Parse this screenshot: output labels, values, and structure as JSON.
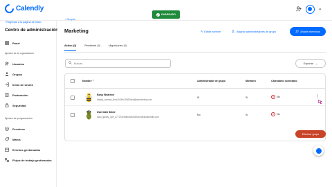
{
  "app": {
    "logo_text": "Calendly",
    "saved_label": "GUARDADO"
  },
  "sidebar": {
    "back_label": "Regresar a la página de inicio",
    "title": "Centro de administración",
    "items_top": [
      {
        "label": "Panel",
        "icon": "grid-icon"
      }
    ],
    "section_org": "Ajustes de la organización",
    "items_org": [
      {
        "label": "Usuarios",
        "icon": "users-icon"
      },
      {
        "label": "Grupos",
        "icon": "groups-icon"
      },
      {
        "label": "Inicio de sesión",
        "icon": "login-icon"
      },
      {
        "label": "Facturación",
        "icon": "billing-icon"
      },
      {
        "label": "Seguridad",
        "icon": "shield-icon"
      }
    ],
    "section_sched": "Ajustes de programación",
    "items_sched": [
      {
        "label": "Permisos",
        "icon": "permissions-icon"
      },
      {
        "label": "Marca",
        "icon": "brand-icon"
      },
      {
        "label": "Eventos gestionados",
        "icon": "events-icon"
      },
      {
        "label": "Flujos de trabajo gestionados",
        "icon": "workflow-icon"
      }
    ]
  },
  "main": {
    "breadcrumb": "Grupos",
    "title": "Marketing",
    "actions": {
      "edit_name": "Editar nombre",
      "assign_admins": "Asignar administradores de grupo",
      "add_members": "Añadir miembros"
    },
    "tabs": [
      {
        "label": "Activo (2)",
        "active": true
      },
      {
        "label": "Pendiente (0)",
        "active": false
      },
      {
        "label": "Migraciones (0)",
        "active": false
      }
    ],
    "search_placeholder": "Buscar...",
    "export_label": "Exportar",
    "table": {
      "headers": {
        "name": "Nombre",
        "group_admin": "Administrador de grupo",
        "members": "Miembro",
        "calendar": "Calendario conectado"
      },
      "rows": [
        {
          "name": "Busy Beatrice",
          "email": "haddy_oomiak_8cac7c09c15d32ded@akcalendly.com",
          "group_admin": "Sí",
          "member": "Sí",
          "calendar": "No"
        },
        {
          "name": "Dun Date Dave",
          "email": "haru_gaddy_cpe_c7727ce6d5ca052080cce@akcalendly.com",
          "group_admin": "No",
          "member": "Sí",
          "calendar": "No"
        }
      ]
    },
    "delete_label": "Eliminar grupo"
  },
  "colors": {
    "brand": "#006bff",
    "success": "#1f8a3b",
    "danger": "#c8452a"
  }
}
